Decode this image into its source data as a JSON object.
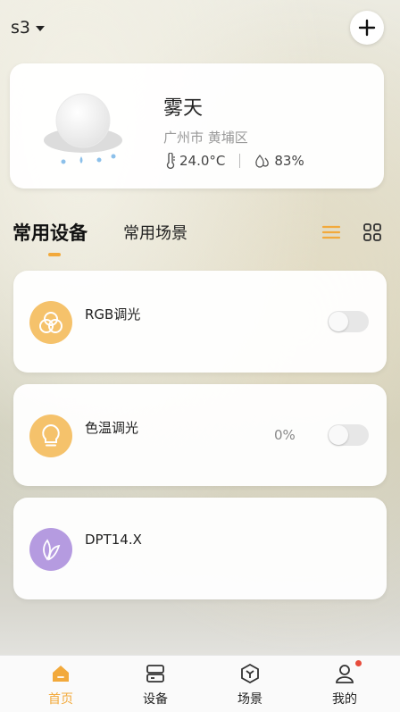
{
  "header": {
    "home_name": "s3"
  },
  "weather": {
    "condition": "雾天",
    "location": "广州市 黄埔区",
    "temperature": "24.0°C",
    "humidity": "83%"
  },
  "tabs": {
    "active": "常用设备",
    "inactive": "常用场景"
  },
  "devices": [
    {
      "name": "RGB调光",
      "value": "",
      "icon": "rgb-light-icon",
      "on": false
    },
    {
      "name": "色温调光",
      "value": "0%",
      "icon": "bulb-icon",
      "on": false
    },
    {
      "name": "DPT14.X",
      "value": "",
      "icon": "leaf-icon"
    }
  ],
  "bottom_nav": [
    {
      "label": "首页",
      "icon": "home-icon",
      "active": true
    },
    {
      "label": "设备",
      "icon": "device-icon",
      "active": false
    },
    {
      "label": "场景",
      "icon": "scene-icon",
      "active": false
    },
    {
      "label": "我的",
      "icon": "user-icon",
      "active": false,
      "badge": true
    }
  ],
  "colors": {
    "accent": "#f2a93b",
    "device_icon_orange": "#f5c26b",
    "device_icon_purple": "#b59be0",
    "badge": "#e74c3c"
  }
}
